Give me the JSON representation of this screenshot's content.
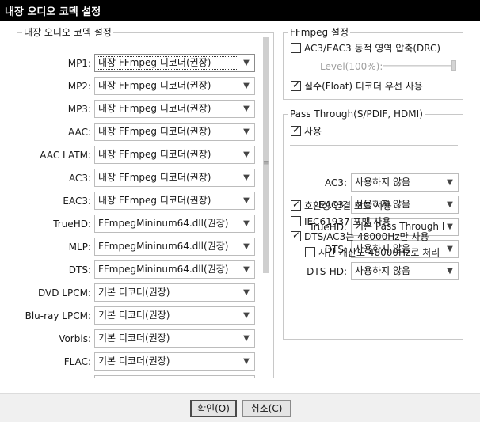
{
  "window": {
    "title": "내장 오디오 코덱 설정"
  },
  "left_group": {
    "legend": "내장 오디오 코덱 설정",
    "codecs": [
      {
        "label": "MP1:",
        "value": "내장 FFmpeg 디코더(권장)"
      },
      {
        "label": "MP2:",
        "value": "내장 FFmpeg 디코더(권장)"
      },
      {
        "label": "MP3:",
        "value": "내장 FFmpeg 디코더(권장)"
      },
      {
        "label": "AAC:",
        "value": "내장 FFmpeg 디코더(권장)"
      },
      {
        "label": "AAC LATM:",
        "value": "내장 FFmpeg 디코더(권장)"
      },
      {
        "label": "AC3:",
        "value": "내장 FFmpeg 디코더(권장)"
      },
      {
        "label": "EAC3:",
        "value": "내장 FFmpeg 디코더(권장)"
      },
      {
        "label": "TrueHD:",
        "value": "FFmpegMininum64.dll(권장)"
      },
      {
        "label": "MLP:",
        "value": "FFmpegMininum64.dll(권장)"
      },
      {
        "label": "DTS:",
        "value": "FFmpegMininum64.dll(권장)"
      },
      {
        "label": "DVD LPCM:",
        "value": "기본 디코더(권장)"
      },
      {
        "label": "Blu-ray LPCM:",
        "value": "기본 디코더(권장)"
      },
      {
        "label": "Vorbis:",
        "value": "기본 디코더(권장)"
      },
      {
        "label": "FLAC:",
        "value": "기본 디코더(권장)"
      },
      {
        "label": "",
        "value": ""
      }
    ]
  },
  "ffmpeg_group": {
    "legend": "FFmpeg 설정",
    "drc": {
      "label": "AC3/EAC3 동적 영역 압축(DRC)",
      "checked": false
    },
    "level_label": "Level(100%):",
    "level_percent": 100,
    "float_decoder": {
      "label": "실수(Float) 디코더 우선 사용",
      "checked": true
    }
  },
  "passthrough_group": {
    "legend": "Pass Through(S/PDIF, HDMI)",
    "enable": {
      "label": "사용",
      "checked": true
    },
    "formats": [
      {
        "label": "AC3:",
        "value": "사용하지 않음"
      },
      {
        "label": "EAC3:",
        "value": "사용하지 않음"
      },
      {
        "label": "TrueHD:",
        "value": "기본 Pass Through I"
      },
      {
        "label": "DTS:",
        "value": "사용하지 않음"
      },
      {
        "label": "DTS-HD:",
        "value": "사용하지 않음"
      }
    ],
    "options": [
      {
        "label": "호환성 연결 모드 사용",
        "checked": true
      },
      {
        "label": "IEC61937 포맷 사용",
        "checked": false
      },
      {
        "label": "DTS/AC3는 48000Hz만 사용",
        "checked": true
      },
      {
        "label": "시간 계산도 48000Hz로 처리",
        "checked": false
      }
    ]
  },
  "icons": {
    "dropdown": "▼",
    "check": "✓",
    "grip": "≡"
  },
  "buttons": {
    "ok": "확인(O)",
    "cancel": "취소(C)"
  }
}
